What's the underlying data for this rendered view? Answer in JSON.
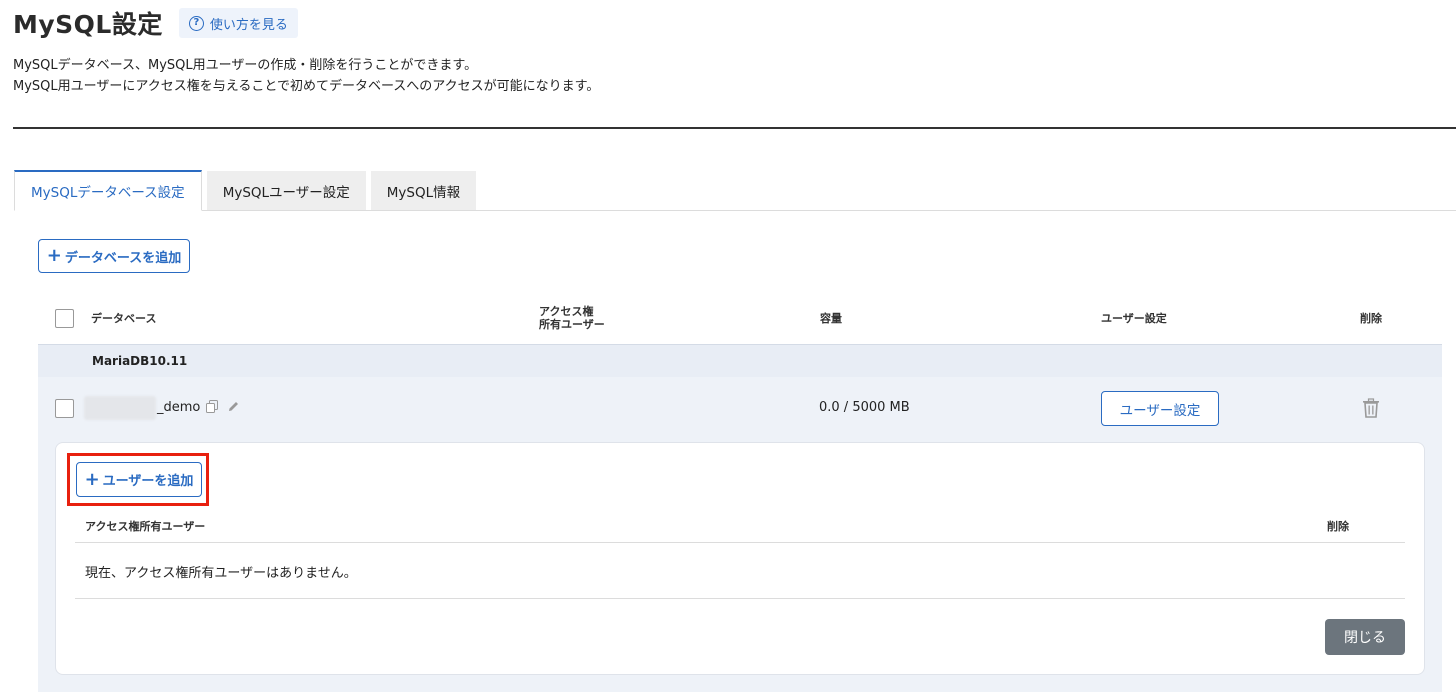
{
  "page": {
    "title": "MySQL設定",
    "help_label": "使い方を見る",
    "description_line1": "MySQLデータベース、MySQL用ユーザーの作成・削除を行うことができます。",
    "description_line2": "MySQL用ユーザーにアクセス権を与えることで初めてデータベースへのアクセスが可能になります。"
  },
  "tabs": [
    {
      "label": "MySQLデータベース設定",
      "active": true
    },
    {
      "label": "MySQLユーザー設定",
      "active": false
    },
    {
      "label": "MySQL情報",
      "active": false
    }
  ],
  "toolbar": {
    "add_database_label": "データベースを追加"
  },
  "table": {
    "headers": {
      "database": "データベース",
      "access_line1": "アクセス権",
      "access_line2": "所有ユーザー",
      "capacity": "容量",
      "user_settings": "ユーザー設定",
      "delete": "削除"
    },
    "group": "MariaDB10.11",
    "row": {
      "name_suffix": "_demo",
      "capacity": "0.0 / 5000 MB",
      "user_settings_button": "ユーザー設定"
    }
  },
  "panel": {
    "add_user_label": "ユーザーを追加",
    "header_access_users": "アクセス権所有ユーザー",
    "header_delete": "削除",
    "empty_message": "現在、アクセス権所有ユーザーはありません。",
    "close_label": "閉じる"
  },
  "colors": {
    "accent": "#2a6bc2",
    "highlight": "#e8200f",
    "close_button": "#6c757d"
  },
  "icons": [
    "question-icon",
    "plus-icon",
    "copy-icon",
    "pencil-icon",
    "trash-icon"
  ]
}
